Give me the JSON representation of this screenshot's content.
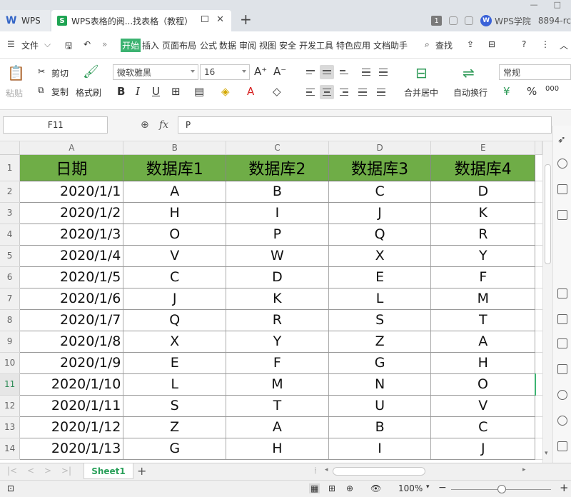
{
  "titlebar": {
    "home_tab": "WPS",
    "doc_tab": "WPS表格的阅...找表格（教程）",
    "wps_college": "WPS学院",
    "user": "8894-rc",
    "badge": "1"
  },
  "menu": {
    "file": "文件",
    "items": [
      "开始",
      "插入",
      "页面布局",
      "公式",
      "数据",
      "审阅",
      "视图",
      "安全",
      "开发工具",
      "特色应用",
      "文档助手"
    ],
    "search": "查找"
  },
  "ribbon": {
    "paste": "粘贴",
    "cut": "剪切",
    "copy": "复制",
    "format_painter": "格式刷",
    "font_name": "微软雅黑",
    "font_size": "16",
    "merge_center": "合并居中",
    "wrap_text": "自动换行",
    "number_format": "常规"
  },
  "formula_bar": {
    "cell_ref": "F11",
    "fx": "fx",
    "value": "P"
  },
  "sheet": {
    "columns": [
      "A",
      "B",
      "C",
      "D",
      "E"
    ],
    "row_numbers": [
      "1",
      "2",
      "3",
      "4",
      "5",
      "6",
      "7",
      "8",
      "9",
      "10",
      "11",
      "12",
      "13",
      "14"
    ],
    "selected_row": "11",
    "header": [
      "日期",
      "数据库1",
      "数据库2",
      "数据库3",
      "数据库4"
    ],
    "rows": [
      [
        "2020/1/1",
        "A",
        "B",
        "C",
        "D"
      ],
      [
        "2020/1/2",
        "H",
        "I",
        "J",
        "K"
      ],
      [
        "2020/1/3",
        "O",
        "P",
        "Q",
        "R"
      ],
      [
        "2020/1/4",
        "V",
        "W",
        "X",
        "Y"
      ],
      [
        "2020/1/5",
        "C",
        "D",
        "E",
        "F"
      ],
      [
        "2020/1/6",
        "J",
        "K",
        "L",
        "M"
      ],
      [
        "2020/1/7",
        "Q",
        "R",
        "S",
        "T"
      ],
      [
        "2020/1/8",
        "X",
        "Y",
        "Z",
        "A"
      ],
      [
        "2020/1/9",
        "E",
        "F",
        "G",
        "H"
      ],
      [
        "2020/1/10",
        "L",
        "M",
        "N",
        "O"
      ],
      [
        "2020/1/11",
        "S",
        "T",
        "U",
        "V"
      ],
      [
        "2020/1/12",
        "Z",
        "A",
        "B",
        "C"
      ],
      [
        "2020/1/13",
        "G",
        "H",
        "I",
        "J"
      ]
    ],
    "header_color": "#6fad47"
  },
  "tabs": {
    "sheet_name": "Sheet1"
  },
  "status": {
    "zoom": "100%"
  }
}
